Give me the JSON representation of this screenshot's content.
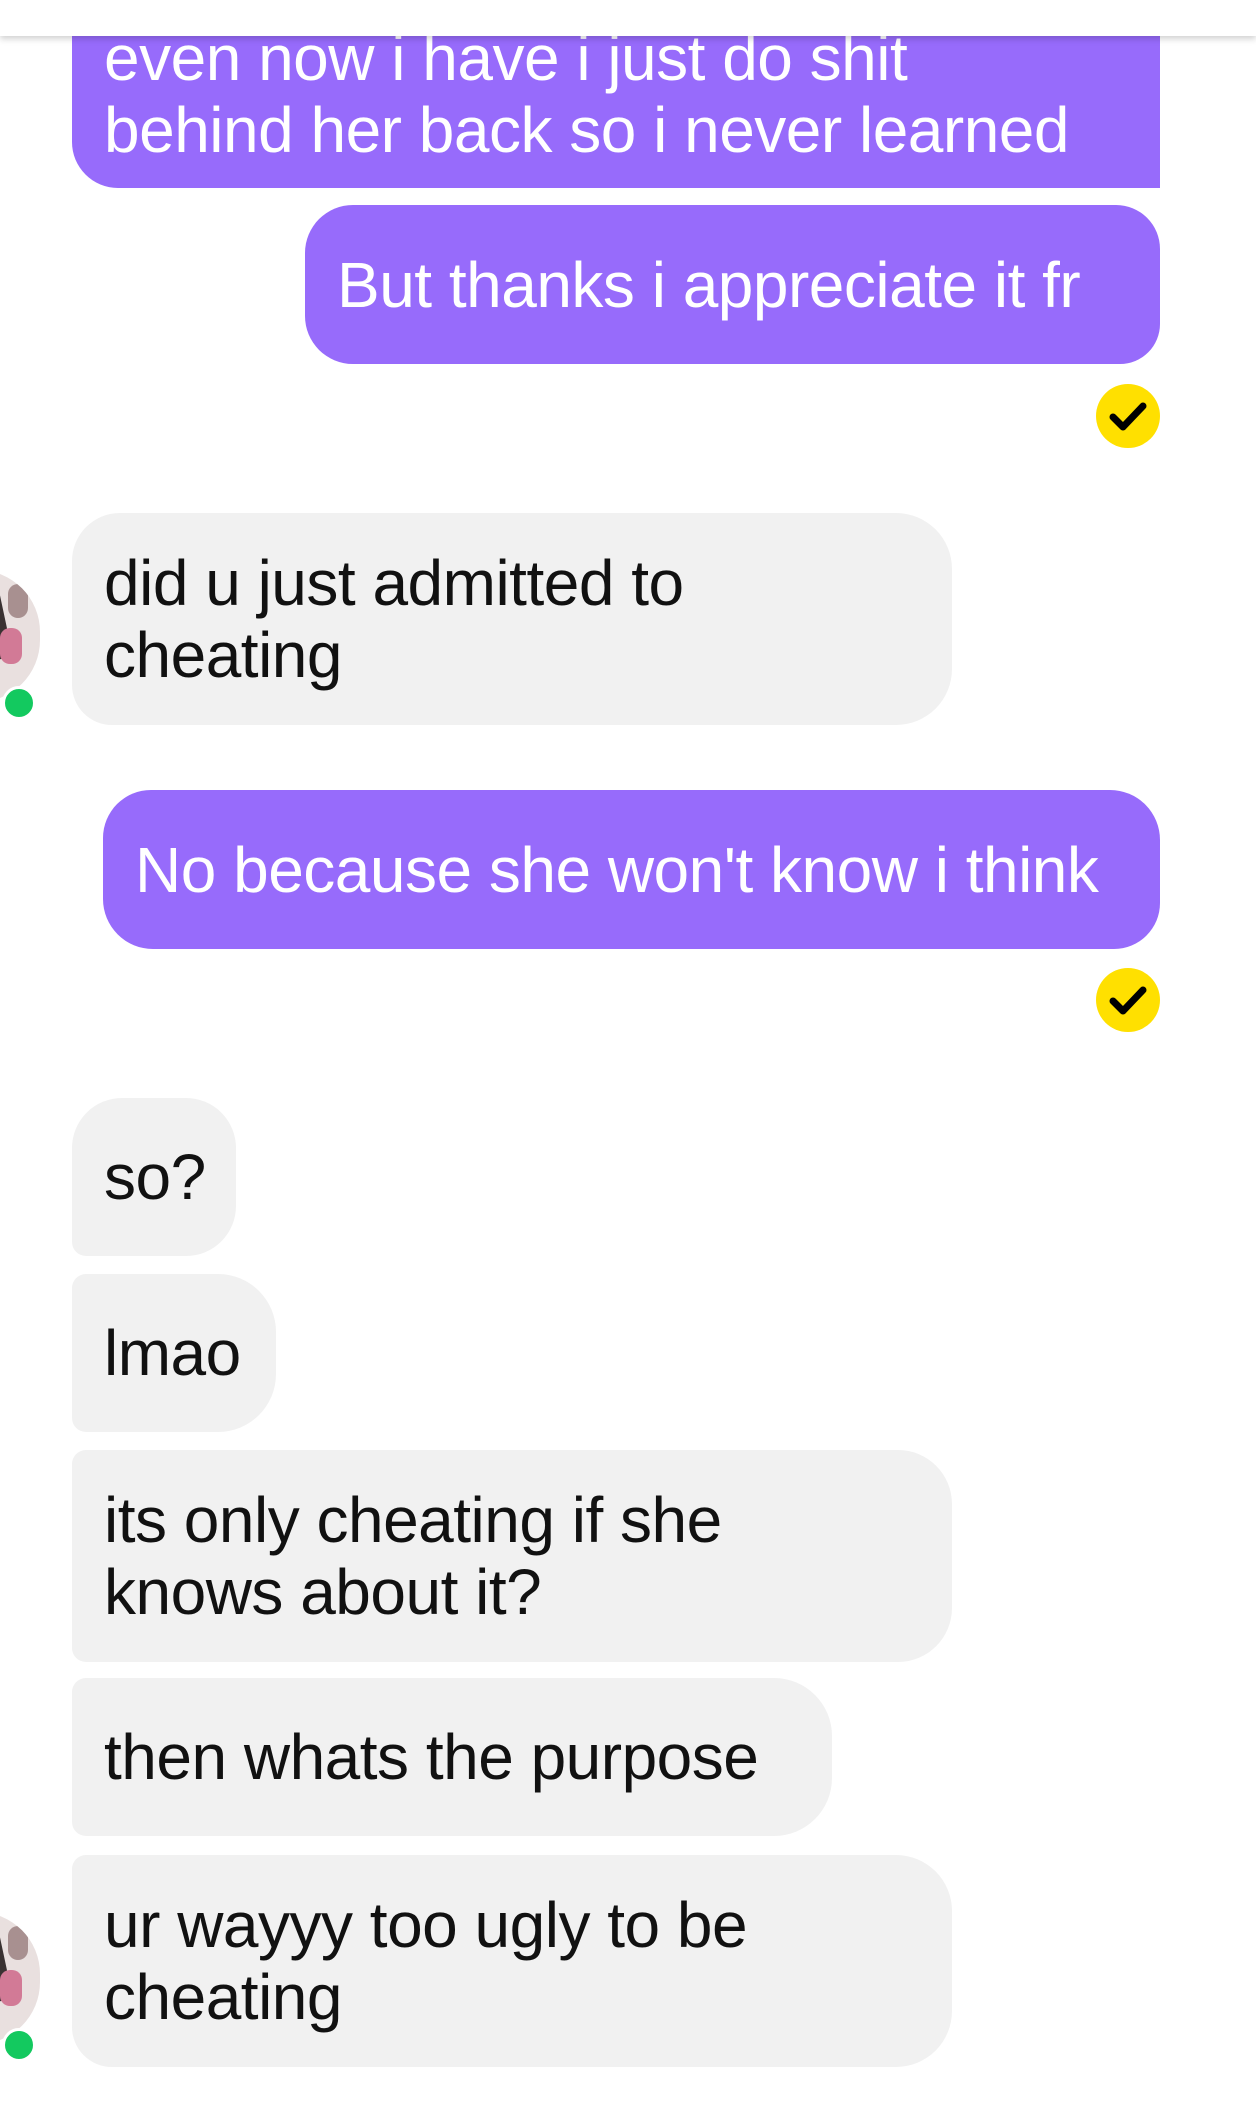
{
  "colors": {
    "sent_bubble": "#976bfb",
    "received_bubble": "#f1f1f1",
    "read_receipt": "#ffe000",
    "online_indicator": "#13c95f"
  },
  "messages": [
    {
      "sender": "me",
      "text": "even now i have i just do shit\nbehind her back so i never learned"
    },
    {
      "sender": "me",
      "text": "But thanks i appreciate it fr",
      "read_receipt_icon": "check-icon"
    },
    {
      "sender": "them",
      "text": "did u just admitted to\ncheating"
    },
    {
      "sender": "me",
      "text": "No because she won't know i think",
      "read_receipt_icon": "check-icon"
    },
    {
      "sender": "them",
      "text": "so?"
    },
    {
      "sender": "them",
      "text": "lmao"
    },
    {
      "sender": "them",
      "text": "its only cheating if she\nknows about it?"
    },
    {
      "sender": "them",
      "text": "then whats the purpose"
    },
    {
      "sender": "them",
      "text": "ur wayyy too ugly to be\ncheating"
    }
  ]
}
